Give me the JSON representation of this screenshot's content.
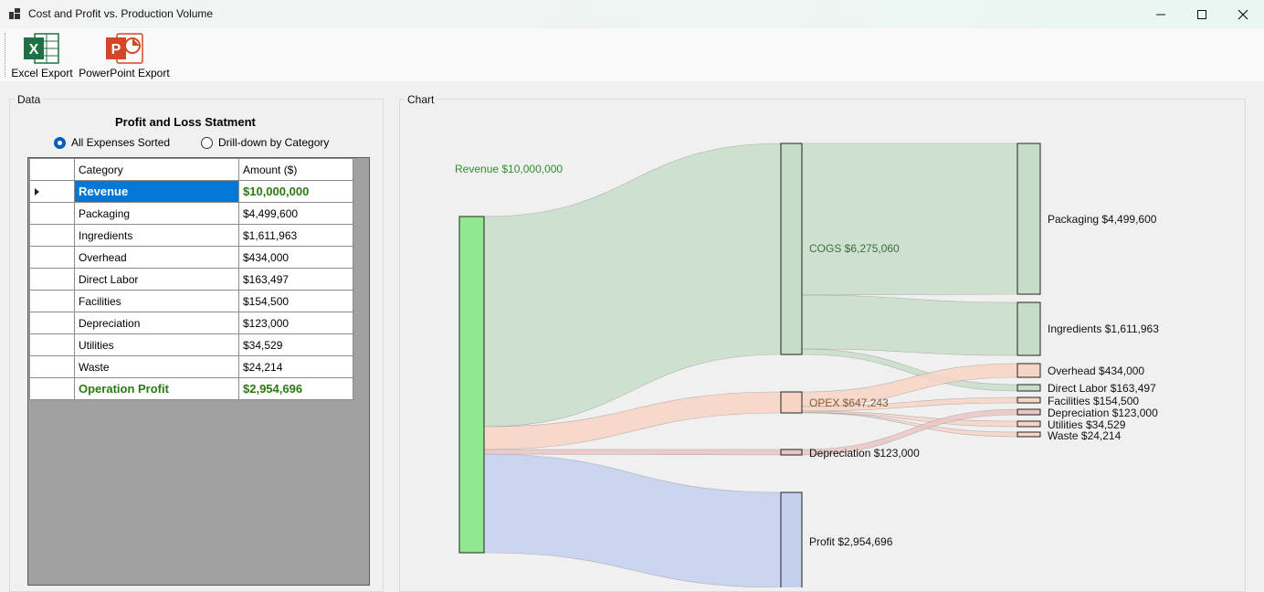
{
  "window": {
    "title": "Cost and Profit vs. Production Volume"
  },
  "toolbar": {
    "excel_label": "Excel Export",
    "ppt_label": "PowerPoint Export",
    "excel_letter": "X",
    "ppt_letter": "P"
  },
  "data_panel": {
    "legend": "Data",
    "title": "Profit and Loss Statment",
    "radio_sorted": "All Expenses Sorted",
    "radio_drilldown": "Drill-down by Category",
    "selected_mode": "All Expenses Sorted",
    "columns": [
      "Category",
      "Amount ($)"
    ],
    "rows": [
      {
        "category": "Revenue",
        "amount": "$10,000,000"
      },
      {
        "category": "Packaging",
        "amount": "$4,499,600"
      },
      {
        "category": "Ingredients",
        "amount": "$1,611,963"
      },
      {
        "category": "Overhead",
        "amount": "$434,000"
      },
      {
        "category": "Direct Labor",
        "amount": "$163,497"
      },
      {
        "category": "Facilities",
        "amount": "$154,500"
      },
      {
        "category": "Depreciation",
        "amount": "$123,000"
      },
      {
        "category": "Utilities",
        "amount": "$34,529"
      },
      {
        "category": "Waste",
        "amount": "$24,214"
      },
      {
        "category": "Operation Profit",
        "amount": "$2,954,696"
      }
    ]
  },
  "chart_panel": {
    "legend": "Chart",
    "labels": {
      "revenue": "Revenue $10,000,000",
      "cogs": "COGS $6,275,060",
      "opex": "OPEX $647,243",
      "depreciation_mid": "Depreciation $123,000",
      "profit": "Profit $2,954,696",
      "packaging": "Packaging $4,499,600",
      "ingredients": "Ingredients $1,611,963",
      "overhead": "Overhead $434,000",
      "direct_labor": "Direct Labor $163,497",
      "facilities": "Facilities $154,500",
      "depreciation": "Depreciation $123,000",
      "utilities": "Utilities $34,529",
      "waste": "Waste $24,214"
    }
  },
  "colors": {
    "revenue_node": "#90e890",
    "cogs_flow": "#c8ddc8",
    "opex_flow": "#f7d5c4",
    "depreciation_flow": "#ecc4c4",
    "profit_flow": "#c5d0ef",
    "revenue_text": "#2f8f2f",
    "opex_text": "#8a5a30",
    "cogs_text": "#3f6a3f"
  },
  "chart_data": {
    "type": "sankey",
    "nodes": [
      "Revenue",
      "COGS",
      "OPEX",
      "Depreciation",
      "Profit",
      "Packaging",
      "Ingredients",
      "Overhead",
      "Direct Labor",
      "Facilities",
      "Depreciation ",
      "Utilities",
      "Waste"
    ],
    "links": [
      {
        "source": "Revenue",
        "target": "COGS",
        "value": 6275060
      },
      {
        "source": "Revenue",
        "target": "OPEX",
        "value": 647243
      },
      {
        "source": "Revenue",
        "target": "Depreciation",
        "value": 123000
      },
      {
        "source": "Revenue",
        "target": "Profit",
        "value": 2954696
      },
      {
        "source": "COGS",
        "target": "Packaging",
        "value": 4499600
      },
      {
        "source": "COGS",
        "target": "Ingredients",
        "value": 1611963
      },
      {
        "source": "COGS",
        "target": "Direct Labor",
        "value": 163497
      },
      {
        "source": "OPEX",
        "target": "Overhead",
        "value": 434000
      },
      {
        "source": "OPEX",
        "target": "Facilities",
        "value": 154500
      },
      {
        "source": "OPEX",
        "target": "Utilities",
        "value": 34529
      },
      {
        "source": "OPEX",
        "target": "Waste",
        "value": 24214
      },
      {
        "source": "Depreciation",
        "target": "Depreciation ",
        "value": 123000
      }
    ]
  }
}
